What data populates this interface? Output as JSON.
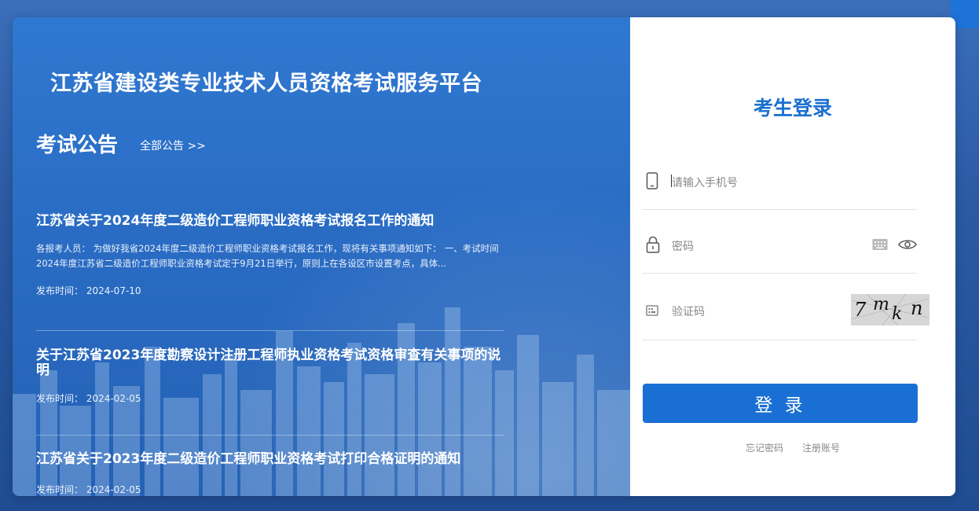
{
  "header": {
    "platform_title": "江苏省建设类专业技术人员资格考试服务平台"
  },
  "notices": {
    "section_title": "考试公告",
    "all_link": "全部公告 >>",
    "items": [
      {
        "title": "江苏省关于2024年度二级造价工程师职业资格考试报名工作的通知",
        "summary": "各报考人员：    为做好我省2024年度二级造价工程师职业资格考试报名工作，现将有关事项通知如下：    一、考试时间 2024年度江苏省二级造价工程师职业资格考试定于9月21日举行，原则上在各设区市设置考点，具体...",
        "date": "发布时间：  2024-07-10"
      },
      {
        "title": "关于江苏省2023年度勘察设计注册工程师执业资格考试资格审查有关事项的说明",
        "summary": "",
        "date": "发布时间：  2024-02-05"
      },
      {
        "title": "江苏省关于2023年度二级造价工程师职业资格考试打印合格证明的通知",
        "summary": "",
        "date": "发布时间：  2024-02-05"
      }
    ]
  },
  "login": {
    "title": "考生登录",
    "phone_placeholder": "请输入手机号",
    "password_placeholder": "密码",
    "captcha_placeholder": "验证码",
    "captcha_text": "7mkn",
    "submit_label": "登 录",
    "forgot_label": "忘记密码",
    "register_label": "注册账号"
  },
  "colors": {
    "accent": "#1a6fd4",
    "panel_blue": "#2f78d1"
  },
  "icons": [
    "phone-icon",
    "lock-icon",
    "keyboard-icon",
    "eye-icon",
    "captcha-icon"
  ]
}
